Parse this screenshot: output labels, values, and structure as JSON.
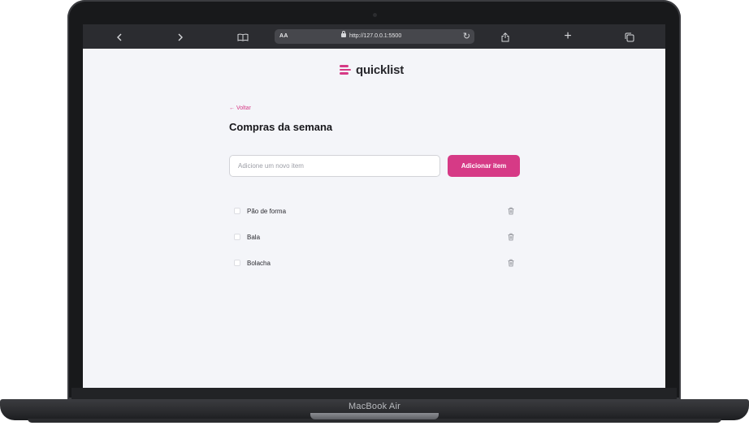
{
  "device": {
    "label": "MacBook Air"
  },
  "browser": {
    "aa_label": "AA",
    "url": "http://127.0.0.1:5500",
    "icons": [
      "back-icon",
      "forward-icon",
      "book-icon",
      "lock-icon",
      "reload-icon",
      "share-icon",
      "plus-icon",
      "tabs-icon"
    ]
  },
  "app": {
    "brand": "quicklist",
    "back_link": "← Voltar",
    "title": "Compras da semana",
    "input_placeholder": "Adicione um novo item",
    "add_button": "Adicionar item",
    "items": [
      {
        "label": "Pão de forma",
        "checked": false
      },
      {
        "label": "Bala",
        "checked": false
      },
      {
        "label": "Bolacha",
        "checked": false
      }
    ]
  },
  "colors": {
    "accent": "#d63a86",
    "page_bg": "#f4f5f9",
    "toolbar_bg": "#2b2c30"
  }
}
